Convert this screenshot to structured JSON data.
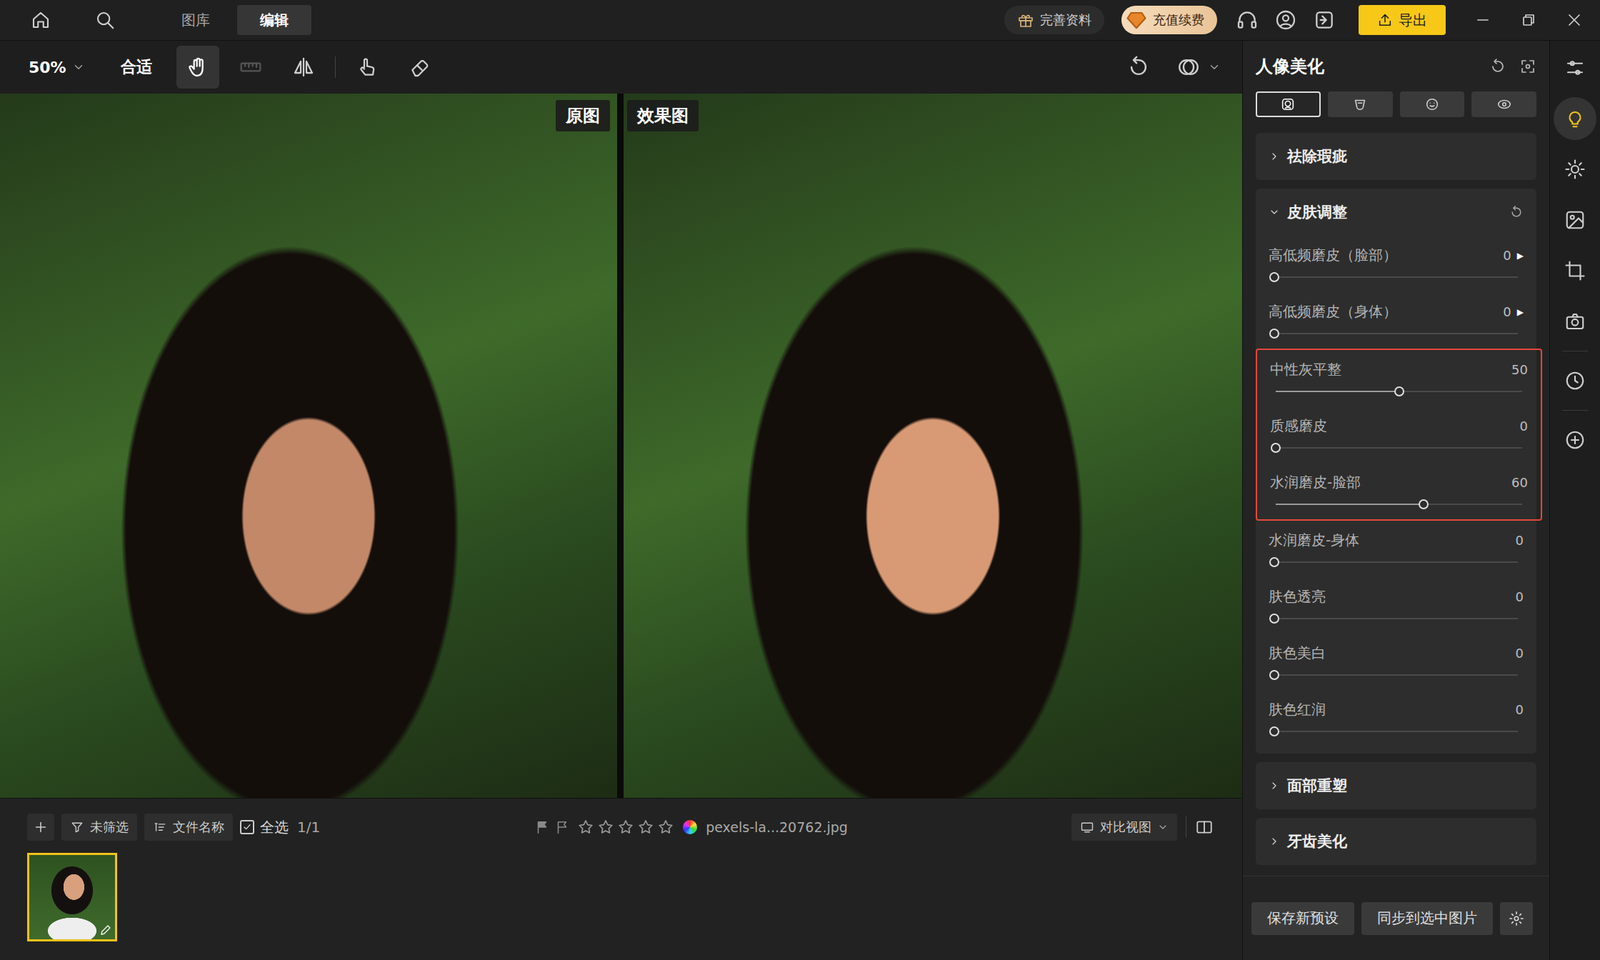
{
  "topbar": {
    "tabs": [
      {
        "label": "图库",
        "selected": false
      },
      {
        "label": "编辑",
        "selected": true
      }
    ],
    "profile_button": "完善资料",
    "recharge_button": "充值续费",
    "export_button": "导出"
  },
  "toolbar": {
    "zoom": "50%",
    "fit": "合适",
    "tools": [
      {
        "selected": true,
        "disabled": false
      },
      {
        "selected": false,
        "disabled": true
      },
      {
        "selected": false,
        "disabled": false
      },
      {
        "selected": false,
        "disabled": false
      },
      {
        "selected": false,
        "disabled": false
      }
    ]
  },
  "compare": {
    "before_label": "原图",
    "after_label": "效果图"
  },
  "filmstrip": {
    "filter": "未筛选",
    "sort": "文件名称",
    "select_all": {
      "label": "全选",
      "checked": true
    },
    "count": "1/1",
    "stars": 0,
    "filename": "pexels-la...20762.jpg",
    "view_mode": "对比视图",
    "thumbnails": [
      {
        "selected": true
      }
    ]
  },
  "panel": {
    "title": "人像美化",
    "subtabs": [
      {
        "selected": true
      },
      {
        "selected": false
      },
      {
        "selected": false
      },
      {
        "selected": false
      }
    ],
    "sections": [
      {
        "title": "祛除瑕疵",
        "expanded": false
      },
      {
        "title": "皮肤调整",
        "expanded": true,
        "sliders": [
          {
            "label": "高低频磨皮（脸部）",
            "value": "0",
            "level": 0,
            "arrow": "▶",
            "highlighted": false
          },
          {
            "label": "高低频磨皮（身体）",
            "value": "0",
            "level": 0,
            "arrow": "▶",
            "highlighted": false
          },
          {
            "label": "中性灰平整",
            "value": "50",
            "level": 0.5,
            "highlighted": true
          },
          {
            "label": "质感磨皮",
            "value": "0",
            "level": 0,
            "highlighted": true
          },
          {
            "label": "水润磨皮-脸部",
            "value": "60",
            "level": 0.6,
            "highlighted": true
          },
          {
            "label": "水润磨皮-身体",
            "value": "0",
            "level": 0,
            "highlighted": false
          },
          {
            "label": "肤色透亮",
            "value": "0",
            "level": 0,
            "highlighted": false
          },
          {
            "label": "肤色美白",
            "value": "0",
            "level": 0,
            "highlighted": false
          },
          {
            "label": "肤色红润",
            "value": "0",
            "level": 0,
            "highlighted": false
          }
        ]
      },
      {
        "title": "面部重塑",
        "expanded": false
      },
      {
        "title": "牙齿美化",
        "expanded": false
      }
    ],
    "footer_buttons": [
      "保存新预设",
      "同步到选中图片"
    ]
  },
  "rail": [
    {
      "selected": false
    },
    {
      "selected": true
    },
    {
      "selected": false
    },
    {
      "selected": false
    },
    {
      "selected": false
    },
    {
      "selected": false
    },
    {
      "selected": false
    },
    {
      "selected": false
    }
  ]
}
